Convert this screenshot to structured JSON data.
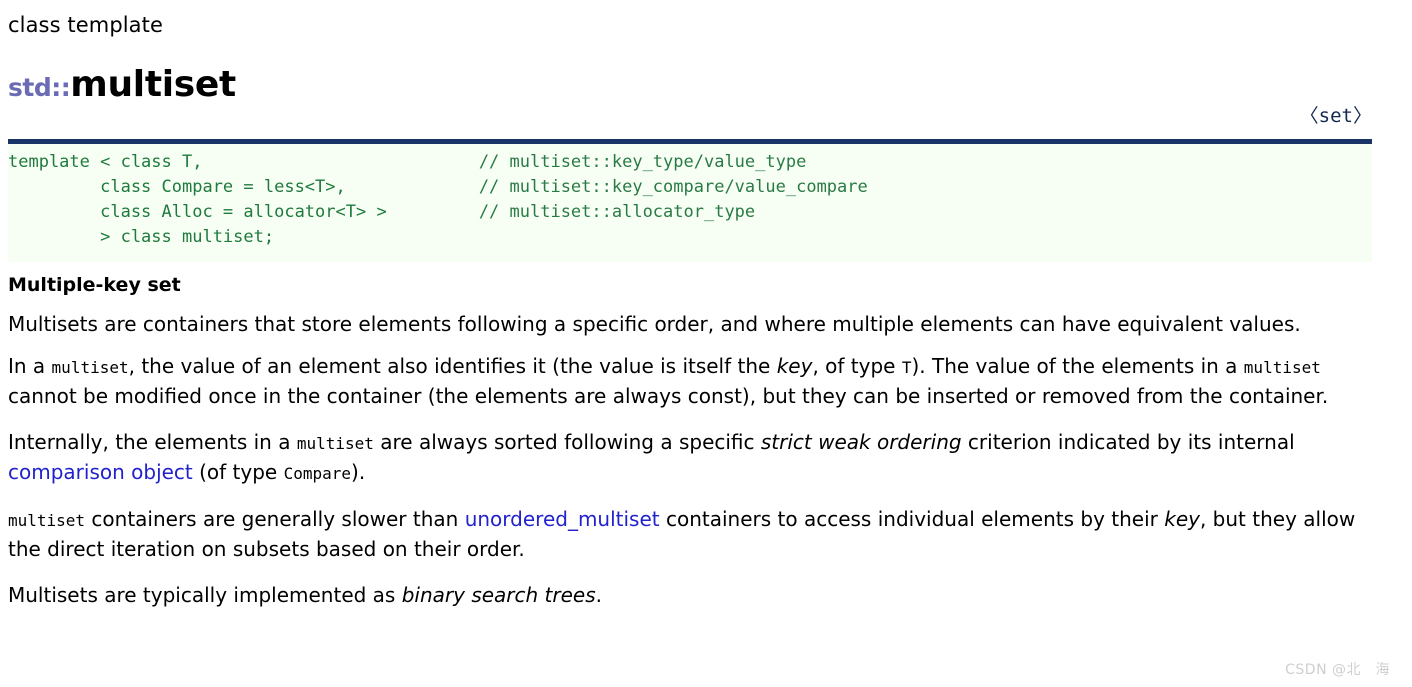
{
  "header": {
    "kind_label": "class template",
    "namespace": "std::",
    "name": "multiset",
    "include_header": "〈set〉"
  },
  "code_block": {
    "language": "cpp",
    "lines": [
      {
        "code": "template < class T,",
        "comment": "// multiset::key_type/value_type"
      },
      {
        "code": "         class Compare = less<T>,",
        "comment": "// multiset::key_compare/value_compare"
      },
      {
        "code": "         class Alloc = allocator<T> >",
        "comment": "// multiset::allocator_type"
      },
      {
        "code": "         > class multiset;",
        "comment": ""
      }
    ]
  },
  "body": {
    "section_title": "Multiple-key set",
    "paragraph1": {
      "p1_t1": "Multisets are containers that store elements following a specific order, and where multiple elements can have equivalent values."
    },
    "paragraph2": {
      "p2_t1": "In a ",
      "p2_c1": "multiset",
      "p2_t2": ", the value of an element also identifies it (the value is itself the ",
      "p2_i1": "key",
      "p2_t3": ", of type ",
      "p2_c2": "T",
      "p2_t4": "). The value of the elements in a ",
      "p2_c3": "multiset",
      "p2_t5": " cannot be modified once in the container (the elements are always const), but they can be inserted or removed from the container."
    },
    "paragraph3": {
      "p3_t1": "Internally, the elements in a ",
      "p3_c1": "multiset",
      "p3_t2": " are always sorted following a specific ",
      "p3_i1": "strict weak ordering",
      "p3_t3": " criterion indicated by its internal ",
      "p3_link1": "comparison object",
      "p3_t4": " (of type ",
      "p3_c2": "Compare",
      "p3_t5": ")."
    },
    "paragraph4": {
      "p4_c1": "multiset",
      "p4_t1": " containers are generally slower than ",
      "p4_link1": "unordered_multiset",
      "p4_t2": " containers to access individual elements by their ",
      "p4_i1": "key",
      "p4_t3": ", but they allow the direct iteration on subsets based on their order."
    },
    "paragraph5": {
      "p5_t1": "Multisets are typically implemented as ",
      "p5_i1": "binary search trees",
      "p5_t2": "."
    }
  },
  "watermark": {
    "text": "CSDN @北　海"
  },
  "colors": {
    "namespace_purple": "#6a6ab5",
    "code_green": "#1f7a3d",
    "code_bg": "#f7fff4",
    "rule_navy": "#1b3468",
    "link_blue": "#2222cc",
    "header_include": "#14284f",
    "watermark_gray": "#cfcfcf"
  }
}
